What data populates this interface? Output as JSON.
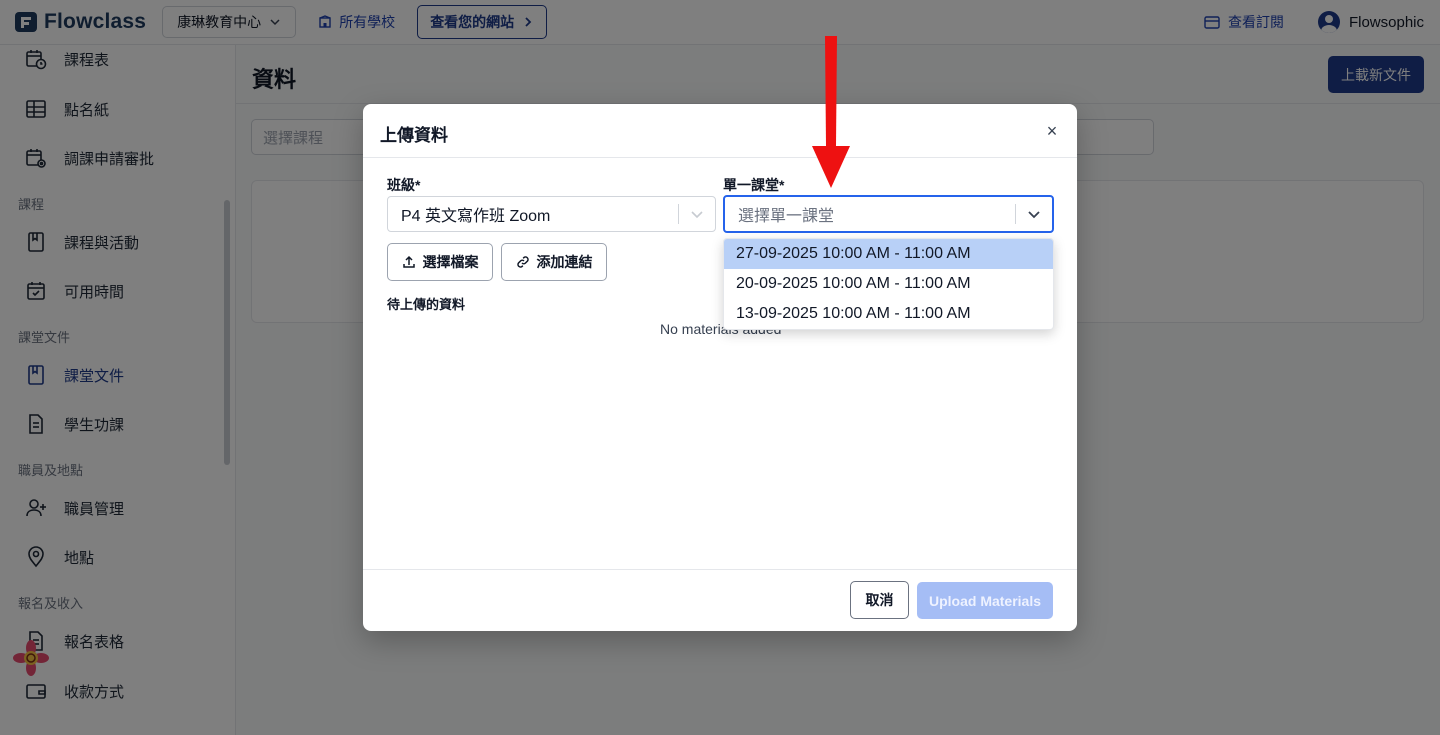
{
  "app": {
    "brand": "Flowclass",
    "school_selector": "康琳教育中心",
    "all_schools": "所有學校",
    "view_site": "查看您的網站",
    "subscription": "查看訂閱",
    "user_name": "Flowsophic"
  },
  "sidebar": {
    "items": [
      {
        "label": "課程表",
        "icon": "calendar-clock-icon"
      },
      {
        "label": "點名紙",
        "icon": "table-grid-icon"
      },
      {
        "label": "調課申請審批",
        "icon": "calendar-settings-icon"
      },
      {
        "section": "課程"
      },
      {
        "label": "課程與活動",
        "icon": "book-icon"
      },
      {
        "label": "可用時間",
        "icon": "calendar-check-icon"
      },
      {
        "section": "課堂文件"
      },
      {
        "label": "課堂文件",
        "icon": "book-icon",
        "active": true
      },
      {
        "label": "學生功課",
        "icon": "document-icon"
      },
      {
        "section": "職員及地點"
      },
      {
        "label": "職員管理",
        "icon": "user-plus-icon"
      },
      {
        "label": "地點",
        "icon": "map-pin-icon"
      },
      {
        "section": "報名及收入"
      },
      {
        "label": "報名表格",
        "icon": "document-icon"
      },
      {
        "label": "收款方式",
        "icon": "wallet-icon"
      }
    ],
    "labels": {
      "schedule": "課程表",
      "attendance": "點名紙",
      "reschedule": "調課申請審批",
      "section_courses": "課程",
      "courses_activities": "課程與活動",
      "availability": "可用時間",
      "section_docs": "課堂文件",
      "class_docs": "課堂文件",
      "homework": "學生功課",
      "section_staff": "職員及地點",
      "staff": "職員管理",
      "locations": "地點",
      "section_enrol": "報名及收入",
      "forms": "報名表格",
      "payment": "收款方式"
    }
  },
  "page": {
    "title": "資料",
    "upload_button": "上載新文件",
    "course_filter_placeholder": "選擇課程"
  },
  "modal": {
    "title": "上傳資料",
    "close": "×",
    "class_label": "班級*",
    "class_value": "P4 英文寫作班 Zoom",
    "lesson_label": "單一課堂*",
    "lesson_placeholder": "選擇單一課堂",
    "choose_file": "選擇檔案",
    "add_link": "添加連結",
    "pending_label": "待上傳的資料",
    "empty_text": "No materials added",
    "cancel": "取消",
    "submit": "Upload Materials",
    "lesson_options": [
      "27-09-2025 10:00 AM - 11:00 AM",
      "20-09-2025 10:00 AM - 11:00 AM",
      "13-09-2025 10:00 AM - 11:00 AM"
    ],
    "highlighted_option_index": 0
  },
  "colors": {
    "brand_navy": "#1e3a8a",
    "focus_blue": "#2563eb",
    "highlight": "#b8d0f7",
    "annotation_arrow": "#ee1111"
  }
}
